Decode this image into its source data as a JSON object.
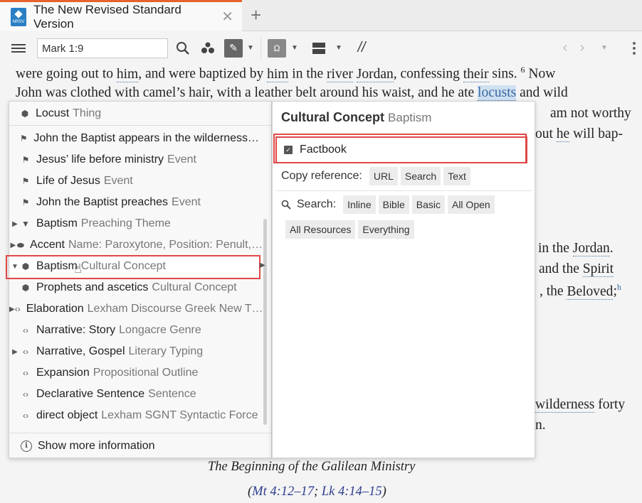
{
  "tab": {
    "title": "The New Revised Standard Version",
    "logo_text": "NRSV",
    "close": "✕",
    "add": "+"
  },
  "toolbar": {
    "reference_value": "Mark 1:9"
  },
  "document": {
    "line1": {
      "pre": "were going out to ",
      "him1": "him",
      "mid1": ", and were baptized by ",
      "him2": "him",
      "mid2": " in the ",
      "river": "river",
      "sp": " ",
      "jordan": "Jordan",
      "mid3": ", confessing ",
      "their": "their",
      "post": " sins.",
      "verse": "6",
      "now": " Now"
    },
    "line2": {
      "pre": "John was clothed with camel’s hair, with a leather belt around his waist, and he ate ",
      "locusts": "locusts",
      "post": " and wild"
    },
    "line3": {
      "text": "am not worthy"
    },
    "line4": {
      "pre": "out ",
      "he": "he",
      "post": " will bap-"
    },
    "line5": {
      "pre": "in the ",
      "jordan": "Jordan",
      "post": "."
    },
    "line6": {
      "pre": "and the ",
      "spirit": "Spirit"
    },
    "line7": {
      "pre": ", the ",
      "beloved": "Beloved",
      "post": ";",
      "note": "h"
    },
    "line8": {
      "wilderness": "wilderness",
      "post": " forty"
    },
    "line9": {
      "text": "n."
    },
    "heading": "The Beginning of the Galilean Ministry",
    "crossref": {
      "open": "(",
      "mt": "Mt 4:12–17",
      "sep": "; ",
      "lk": "Lk 4:14–15",
      "close": ")"
    }
  },
  "left_panel": {
    "header": {
      "name": "Locust",
      "type": "Thing"
    },
    "items": [
      {
        "name": "John the Baptist appears in the wilderness…",
        "type": "",
        "arrow": "",
        "icon": "flag"
      },
      {
        "name": "Jesus’ life before ministry",
        "type": "Event",
        "arrow": "",
        "icon": "flag"
      },
      {
        "name": "Life of Jesus",
        "type": "Event",
        "arrow": "",
        "icon": "flag"
      },
      {
        "name": "John the Baptist preaches",
        "type": "Event",
        "arrow": "",
        "icon": "flag"
      },
      {
        "name": "Baptism",
        "type": "Preaching Theme",
        "arrow": "▶",
        "icon": "trash"
      },
      {
        "name": "Accent",
        "type": "Name: Paroxytone, Position: Penult,…",
        "arrow": "▶",
        "icon": "tag"
      },
      {
        "name": "Baptism",
        "type": "Cultural Concept",
        "arrow": "▼",
        "icon": "hex"
      },
      {
        "name": "Prophets and ascetics",
        "type": "Cultural Concept",
        "arrow": "",
        "icon": "hex"
      },
      {
        "name": "Elaboration",
        "type": "Lexham Discourse Greek New T…",
        "arrow": "▶",
        "icon": "code"
      },
      {
        "name": "Narrative: Story",
        "type": "Longacre Genre",
        "arrow": "",
        "icon": "code"
      },
      {
        "name": "Narrative, Gospel",
        "type": "Literary Typing",
        "arrow": "▶",
        "icon": "code"
      },
      {
        "name": "Expansion",
        "type": "Propositional Outline",
        "arrow": "",
        "icon": "code"
      },
      {
        "name": "Declarative Sentence",
        "type": "Sentence",
        "arrow": "",
        "icon": "code"
      },
      {
        "name": "direct object",
        "type": "Lexham SGNT Syntactic Force",
        "arrow": "",
        "icon": "code"
      }
    ],
    "footer": "Show more information"
  },
  "right_panel": {
    "title": "Cultural Concept",
    "subtitle": "Baptism",
    "factbook": "Factbook",
    "copy_label": "Copy reference:",
    "copy_buttons": [
      "URL",
      "Search",
      "Text"
    ],
    "search_label": "Search:",
    "search_buttons": [
      "Inline",
      "Bible",
      "Basic",
      "All Open",
      "All Resources",
      "Everything"
    ]
  },
  "colors": {
    "accent": "#e8632b",
    "highlight_box": "#e04848",
    "link_blue": "#3869a0"
  }
}
